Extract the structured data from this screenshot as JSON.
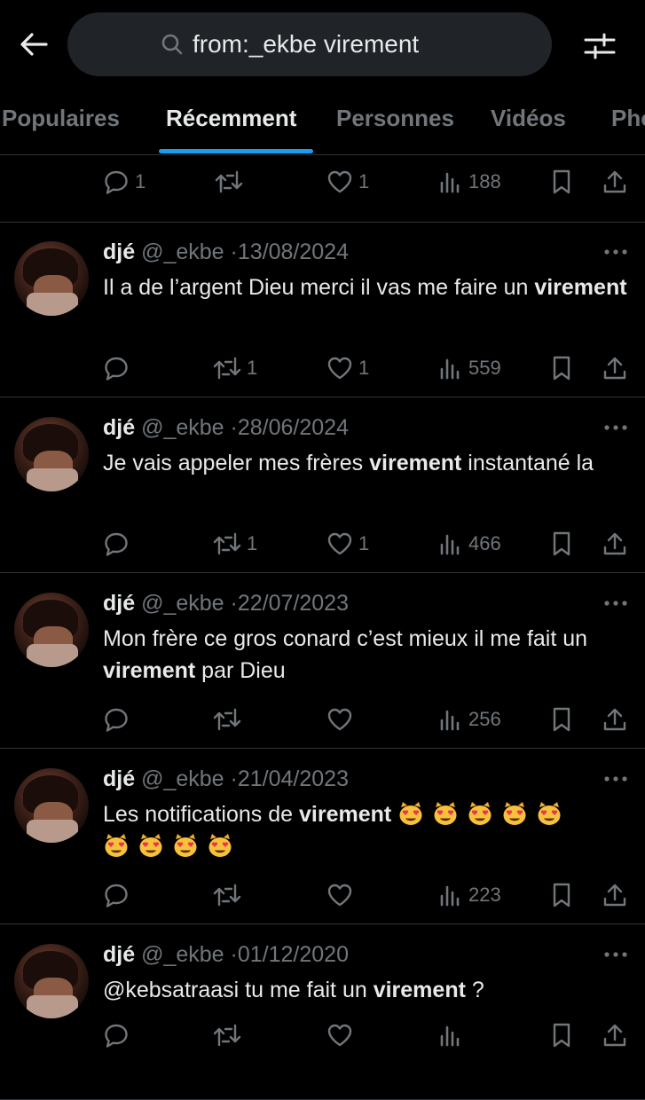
{
  "search": {
    "query": "from:_ekbe virement"
  },
  "tabs": [
    "Populaires",
    "Récemment",
    "Personnes",
    "Vidéos",
    "Photos"
  ],
  "active_tab": "Récemment",
  "accent_color": "#1d9bf0",
  "top_partial_actions": {
    "replies": "1",
    "retweets": "",
    "likes": "1",
    "views": "188"
  },
  "tweets": [
    {
      "name": "djé",
      "handle": "@_ekbe",
      "date": "13/08/2024",
      "text": {
        "before": "Il a de l’argent Dieu merci il vas me faire un ",
        "highlight": "virement",
        "after": ""
      },
      "stats": {
        "replies": "",
        "retweets": "1",
        "likes": "1",
        "views": "559"
      }
    },
    {
      "name": "djé",
      "handle": "@_ekbe",
      "date": "28/06/2024",
      "text": {
        "before": "Je vais appeler mes frères ",
        "highlight": "virement",
        "after": " instantané la"
      },
      "stats": {
        "replies": "",
        "retweets": "1",
        "likes": "1",
        "views": "466"
      }
    },
    {
      "name": "djé",
      "handle": "@_ekbe",
      "date": "22/07/2023",
      "text": {
        "before": "Mon frère ce gros conard c’est mieux il me fait un ",
        "highlight": "virement",
        "after": " par Dieu"
      },
      "stats": {
        "replies": "",
        "retweets": "",
        "likes": "",
        "views": "256"
      }
    },
    {
      "name": "djé",
      "handle": "@_ekbe",
      "date": "21/04/2023",
      "text": {
        "before": "Les notifications de ",
        "highlight": "virement",
        "after": " "
      },
      "emojis": [
        "heart-eyes-cat",
        "heart-eyes-cat",
        "heart-eyes-cat",
        "heart-eyes-cat",
        "heart-eyes-cat",
        "heart-eyes-cat",
        "heart-eyes-cat",
        "heart-eyes-cat",
        "heart-eyes-cat"
      ],
      "stats": {
        "replies": "",
        "retweets": "",
        "likes": "",
        "views": "223"
      }
    },
    {
      "name": "djé",
      "handle": "@_ekbe",
      "date": "01/12/2020",
      "text": {
        "mention": "@kebsatraasi",
        "before": " tu me fait un ",
        "highlight": "virement",
        "after": " ?"
      },
      "stats": {
        "replies": "",
        "retweets": "",
        "likes": "",
        "views": ""
      }
    }
  ]
}
